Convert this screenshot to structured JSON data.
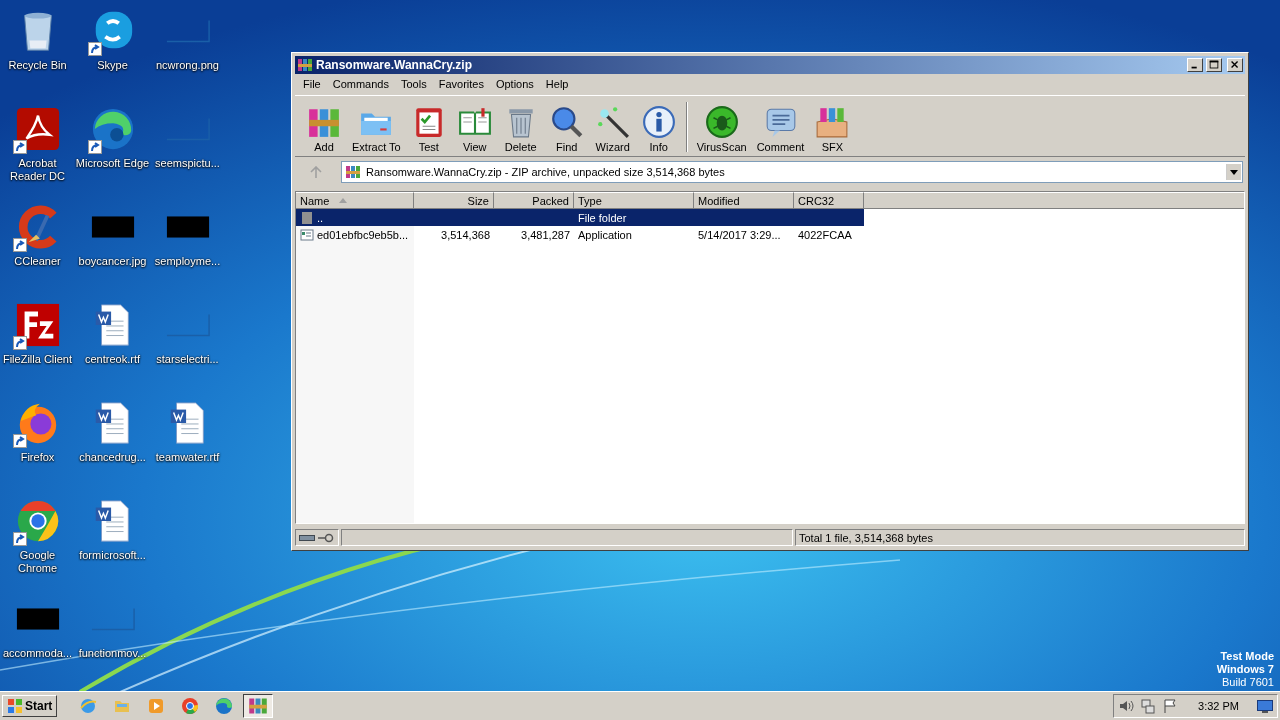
{
  "desktop": {
    "icons": [
      {
        "label": "Recycle Bin",
        "kind": "recycle",
        "shortcut": false
      },
      {
        "label": "Acrobat Reader DC",
        "kind": "acrobat",
        "shortcut": true
      },
      {
        "label": "CCleaner",
        "kind": "ccleaner",
        "shortcut": true
      },
      {
        "label": "FileZilla Client",
        "kind": "filezilla",
        "shortcut": true
      },
      {
        "label": "Firefox",
        "kind": "firefox",
        "shortcut": true
      },
      {
        "label": "Google Chrome",
        "kind": "chrome",
        "shortcut": true
      },
      {
        "label": "accommoda...",
        "kind": "dark",
        "shortcut": false
      },
      {
        "label": "Skype",
        "kind": "skype",
        "shortcut": true
      },
      {
        "label": "Microsoft Edge",
        "kind": "edge",
        "shortcut": true
      },
      {
        "label": "boycancer.jpg",
        "kind": "dark",
        "shortcut": false
      },
      {
        "label": "centreok.rtf",
        "kind": "word",
        "shortcut": false
      },
      {
        "label": "chancedrug...",
        "kind": "word",
        "shortcut": false
      },
      {
        "label": "formicrosoft...",
        "kind": "word",
        "shortcut": false
      },
      {
        "label": "functionmov...",
        "kind": "blank",
        "shortcut": false
      },
      {
        "label": "ncwrong.png",
        "kind": "blank",
        "shortcut": false
      },
      {
        "label": "seemspictu...",
        "kind": "blank",
        "shortcut": false
      },
      {
        "label": "semployme...",
        "kind": "dark",
        "shortcut": false
      },
      {
        "label": "starselectri...",
        "kind": "blank",
        "shortcut": false
      },
      {
        "label": "teamwater.rtf",
        "kind": "word",
        "shortcut": false
      }
    ],
    "os_notice": [
      "Test Mode",
      "Windows 7",
      "Build 7601"
    ]
  },
  "window": {
    "title": "Ransomware.WannaCry.zip",
    "menu": [
      "File",
      "Commands",
      "Tools",
      "Favorites",
      "Options",
      "Help"
    ],
    "toolbar": {
      "groups": [
        [
          {
            "label": "Add"
          },
          {
            "label": "Extract To"
          },
          {
            "label": "Test"
          },
          {
            "label": "View"
          },
          {
            "label": "Delete"
          },
          {
            "label": "Find"
          },
          {
            "label": "Wizard"
          },
          {
            "label": "Info"
          }
        ],
        [
          {
            "label": "VirusScan"
          },
          {
            "label": "Comment"
          },
          {
            "label": "SFX"
          }
        ]
      ]
    },
    "address": {
      "text": "Ransomware.WannaCry.zip - ZIP archive, unpacked size 3,514,368 bytes",
      "up_disabled": true
    },
    "columns": [
      {
        "label": "Name",
        "sorted": true
      },
      {
        "label": "Size",
        "sorted": false
      },
      {
        "label": "Packed",
        "sorted": false
      },
      {
        "label": "Type",
        "sorted": false
      },
      {
        "label": "Modified",
        "sorted": false
      },
      {
        "label": "CRC32",
        "sorted": false
      }
    ],
    "rows": [
      {
        "kind": "folder",
        "selected": true,
        "cells": [
          "..",
          "",
          "",
          "File folder",
          "",
          ""
        ]
      },
      {
        "kind": "file",
        "selected": false,
        "cells": [
          "ed01ebfbc9eb5b...",
          "3,514,368",
          "3,481,287",
          "Application",
          "5/14/2017 3:29...",
          "4022FCAA"
        ]
      }
    ],
    "status_bar": {
      "text": "Total 1 file, 3,514,368 bytes"
    }
  },
  "taskbar": {
    "start": "Start",
    "apps": [
      {
        "selected": false
      },
      {
        "selected": false
      },
      {
        "selected": false
      },
      {
        "selected": false
      },
      {
        "selected": false
      },
      {
        "selected": true
      }
    ],
    "clock": "3:32 PM"
  }
}
